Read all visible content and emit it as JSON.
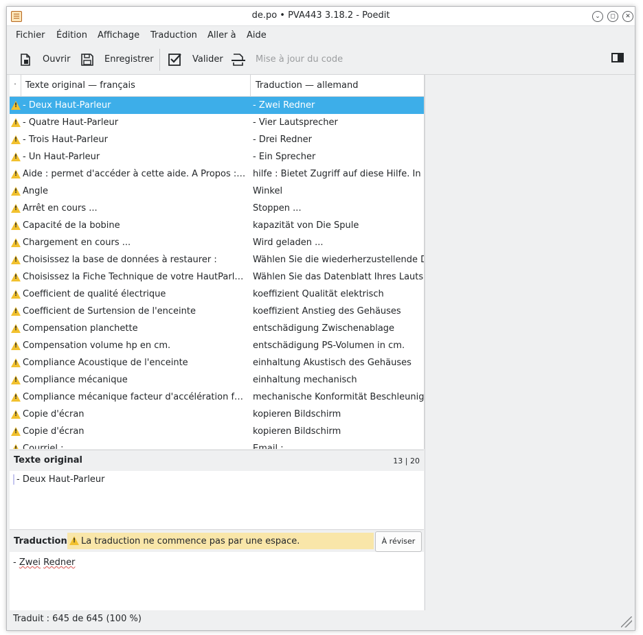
{
  "window": {
    "title": "de.po • PVA443 3.18.2 - Poedit"
  },
  "menu": [
    "Fichier",
    "Édition",
    "Affichage",
    "Traduction",
    "Aller à",
    "Aide"
  ],
  "toolbar": {
    "open_label": "Ouvrir",
    "save_label": "Enregistrer",
    "validate_label": "Valider",
    "update_label": "Mise à jour du code"
  },
  "list": {
    "header_dot": "·",
    "col_source": "Texte original — français",
    "col_translation": "Traduction — allemand",
    "rows": [
      {
        "src": "- Deux Haut-Parleur",
        "tr": "- Zwei Redner"
      },
      {
        "src": "- Quatre Haut-Parleur",
        "tr": "- Vier Lautsprecher"
      },
      {
        "src": "- Trois Haut-Parleur",
        "tr": "- Drei Redner"
      },
      {
        "src": "- Un Haut-Parleur",
        "tr": "- Ein Sprecher"
      },
      {
        "src": "Aide : permet d'accéder à cette aide.  A Propos : Acc...",
        "tr": "hilfe : Bietet Zugriff auf diese Hilfe.  In Be"
      },
      {
        "src": "Angle",
        "tr": "Winkel"
      },
      {
        "src": "Arrêt en cours ...",
        "tr": "Stoppen ..."
      },
      {
        "src": "Capacité de  la bobine",
        "tr": "kapazität von Die Spule"
      },
      {
        "src": "Chargement en cours ...",
        "tr": "Wird geladen ..."
      },
      {
        "src": "Choisissez la base de données à restaurer :",
        "tr": "Wählen Sie die wiederherzustellende Dat"
      },
      {
        "src": "Choisissez la Fiche Technique de votre HautParleur :",
        "tr": "Wählen Sie das Datenblatt Ihres Lautspre"
      },
      {
        "src": "Coefficient  de qualité électrique",
        "tr": "koeffizient Qualität elektrisch"
      },
      {
        "src": "Coefficient  de Surtension de l'enceinte",
        "tr": "koeffizient Anstieg des Gehäuses"
      },
      {
        "src": "Compensation planchette",
        "tr": "entschädigung Zwischenablage"
      },
      {
        "src": "Compensation volume hp en cm.",
        "tr": "entschädigung PS-Volumen in cm."
      },
      {
        "src": "Compliance  Acoustique de l'enceinte",
        "tr": "einhaltung Akustisch des Gehäuses"
      },
      {
        "src": "Compliance mécanique",
        "tr": "einhaltung mechanisch"
      },
      {
        "src": "Compliance mécanique facteur d'accélération facte...",
        "tr": "mechanische Konformität Beschleunigur"
      },
      {
        "src": "Copie d'écran",
        "tr": "kopieren Bildschirm"
      },
      {
        "src": "Copie  d'écran",
        "tr": "kopieren Bildschirm"
      },
      {
        "src": "Courriel :",
        "tr": "Email :"
      }
    ]
  },
  "source_panel": {
    "title": "Texte original",
    "count": "13 | 20",
    "text": "- Deux Haut-Parleur"
  },
  "translation_panel": {
    "title": "Traduction",
    "warning": "La traduction ne commence pas par une espace.",
    "review_button": "À réviser",
    "text_prefix": "- ",
    "text_word1": "Zwei",
    "text_space": " ",
    "text_word2": "Redner"
  },
  "status": {
    "text": "Traduit : 645 de 645 (100 %)"
  },
  "colors": {
    "selection": "#3daee9",
    "warning_bg": "#f9e6a9",
    "warning_icon": "#f2c12e"
  }
}
